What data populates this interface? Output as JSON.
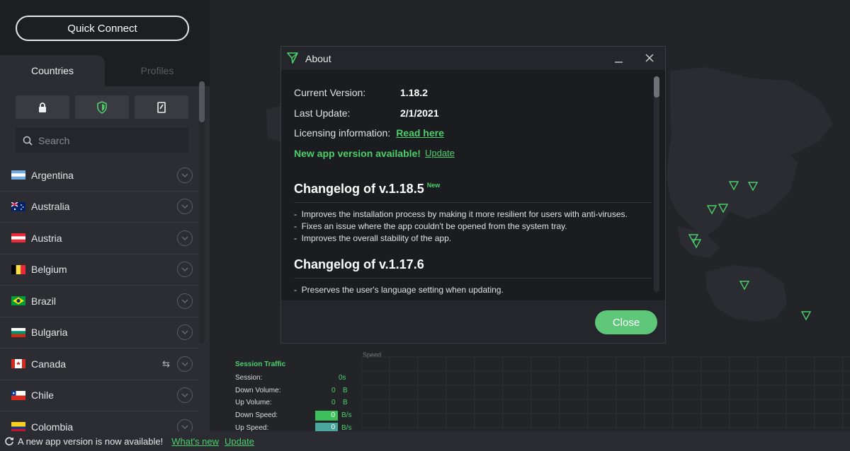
{
  "sidebar": {
    "quick_connect_label": "Quick Connect",
    "tabs": [
      {
        "label": "Countries",
        "active": true
      },
      {
        "label": "Profiles",
        "active": false
      }
    ],
    "filters": [
      {
        "icon": "lock-icon"
      },
      {
        "icon": "shield-icon"
      },
      {
        "icon": "server-icon"
      }
    ],
    "search": {
      "placeholder": "Search",
      "value": ""
    },
    "countries": [
      {
        "name": "Argentina"
      },
      {
        "name": "Australia"
      },
      {
        "name": "Austria"
      },
      {
        "name": "Belgium"
      },
      {
        "name": "Brazil"
      },
      {
        "name": "Bulgaria"
      },
      {
        "name": "Canada"
      },
      {
        "name": "Chile"
      },
      {
        "name": "Colombia"
      }
    ]
  },
  "about_dialog": {
    "title": "About",
    "current_version_label": "Current Version:",
    "current_version": "1.18.2",
    "last_update_label": "Last Update:",
    "last_update": "2/1/2021",
    "licensing_label": "Licensing information:",
    "licensing_link": "Read here",
    "new_version_text": "New app version available!",
    "update_link": "Update",
    "changelogs": [
      {
        "heading": "Changelog of v.1.18.5",
        "badge": "New",
        "items": [
          "Improves the installation process by making it more resilient for users with anti-viruses.",
          "Fixes an issue where the app couldn't be opened from the system tray.",
          "Improves the overall stability of the app."
        ]
      },
      {
        "heading": "Changelog of v.1.17.6",
        "badge": "",
        "items": [
          "Preserves the user's language setting when updating."
        ]
      }
    ],
    "close_label": "Close"
  },
  "traffic": {
    "title": "Session Traffic",
    "session_label": "Session:",
    "session_value": "0s",
    "down_volume_label": "Down Volume:",
    "down_volume_value": "0",
    "down_volume_unit": "B",
    "up_volume_label": "Up Volume:",
    "up_volume_value": "0",
    "up_volume_unit": "B",
    "down_speed_label": "Down Speed:",
    "down_speed_value": "0",
    "down_speed_unit": "B/s",
    "up_speed_label": "Up Speed:",
    "up_speed_value": "0",
    "up_speed_unit": "B/s",
    "speed_chart_label": "Speed"
  },
  "statusbar": {
    "message": "A new app version is now available!",
    "whats_new": "What's new",
    "update": "Update"
  },
  "colors": {
    "accent_green": "#4ccf6a",
    "close_button": "#5fc77a",
    "sidebar_bg": "#1d1e22",
    "panel_bg": "#2c2d32",
    "dialog_bg": "#1b1c20"
  }
}
